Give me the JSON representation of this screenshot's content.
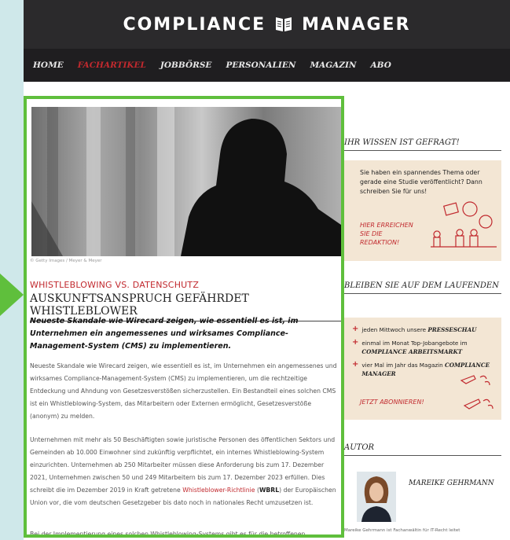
{
  "site": {
    "logo_left": "COMPLIANCE",
    "logo_right": "MANAGER"
  },
  "nav": [
    {
      "label": "HOME",
      "active": false
    },
    {
      "label": "FACHARTIKEL",
      "active": true
    },
    {
      "label": "JOBBÖRSE",
      "active": false
    },
    {
      "label": "PERSONALIEN",
      "active": false
    },
    {
      "label": "MAGAZIN",
      "active": false
    },
    {
      "label": "ABO",
      "active": false
    }
  ],
  "article": {
    "image_credit": "© Getty Images / Meyer & Meyer",
    "kicker": "WHISTLEBLOWING VS. DATENSCHUTZ",
    "headline": "AUSKUNFTSANSPRUCH GEFÄHRDET WHISTLEBLOWER",
    "lead": "Neueste Skandale wie Wirecard zeigen, wie essentiell es ist, im Unternehmen ein angemessenes und wirksames Compliance-Management-System (CMS) zu implementieren.",
    "para1": "Neueste Skandale wie Wirecard zeigen, wie essentiell es ist, im Unternehmen ein angemessenes und wirksames Compliance-Management-System (CMS) zu implementieren, um die rechtzeitige Entdeckung und Ahndung von Gesetzesverstößen sicherzustellen. Ein Bestandteil eines solchen CMS ist ein Whistleblowing-System, das Mitarbeitern oder Externen ermöglicht, Gesetzesverstöße (anonym) zu melden.",
    "para2_a": "Unternehmen mit mehr als 50 Beschäftigten sowie juristische Personen des öffentlichen Sektors und Gemeinden ab 10.000 Einwohner sind zukünftig verpflichtet, ein internes Whistleblowing-System einzurichten. Unternehmen ab 250 Mitarbeiter müssen diese Anforderung bis zum 17. Dezember 2021, Unternehmen zwischen 50 und 249 Mitarbeitern bis zum 17. Dezember 2023 erfüllen. Dies schreibt die im Dezember 2019 in Kraft getretene ",
    "para2_link": "Whistleblower-Richtlinie",
    "para2_b": " (",
    "para2_bold": "WBRL",
    "para2_c": ") der Europäischen Union vor, die vom deutschen Gesetzgeber bis dato noch in nationales Recht umzusetzen ist.",
    "para3": "Bei der Implementierung eines solchen Whistleblowing-Systems gibt es für die betroffenen"
  },
  "sidebar": {
    "section1_title": "IHR WISSEN IST GEFRAGT!",
    "section1_text": "Sie haben ein spannendes Thema oder gerade eine Studie veröffentlicht? Dann schreiben Sie für uns!",
    "section1_cta": [
      "HIER ERREICHEN",
      "SIE DIE",
      "REDAKTION!"
    ],
    "section2_title": "BLEIBEN SIE AUF DEM LAUFENDEN",
    "section2_items": [
      {
        "pre": "jeden Mittwoch unsere ",
        "bold": "PRESSESCHAU"
      },
      {
        "pre": "einmal im Monat Top-Jobangebote im ",
        "bold": "COMPLIANCE ARBEITSMARKT"
      },
      {
        "pre": "vier Mal im Jahr das Magazin ",
        "bold": "COMPLIANCE MANAGER"
      }
    ],
    "section2_cta": "JETZT ABONNIEREN!",
    "section3_title": "AUTOR",
    "author_name": "MAREIKE GEHRMANN",
    "author_bio": "Mareike Gehrmann ist Fachanwältin für IT-Recht leitet"
  },
  "colors": {
    "accent": "#c1292e",
    "highlight": "#5fbf3c",
    "box": "#f3e6d4",
    "nav_bg": "#1f1e20"
  }
}
